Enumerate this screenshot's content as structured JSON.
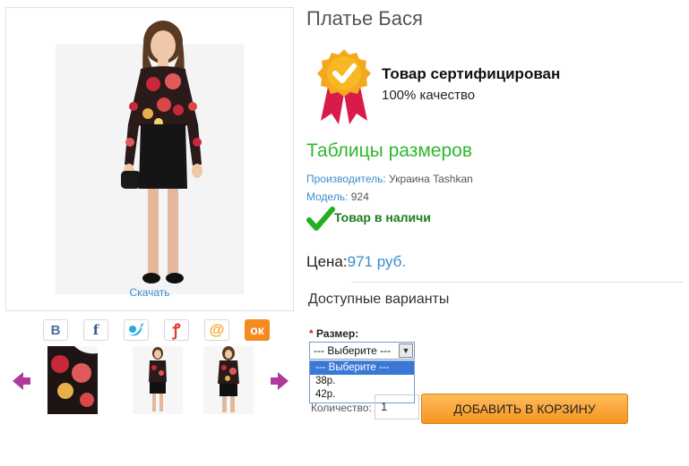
{
  "product": {
    "title": "Платье Бася",
    "download_label": "Скачать"
  },
  "certificate": {
    "title": "Товар сертифицирован",
    "subtitle": "100% качество"
  },
  "size_table_link": "Таблицы размеров",
  "meta": {
    "manufacturer_label": "Производитель:",
    "manufacturer_value": "Украина Tashkan",
    "model_label": "Модель:",
    "model_value": "924"
  },
  "stock": "Товар в наличи",
  "price": {
    "label": "Цена:",
    "value": "971 руб."
  },
  "variants": {
    "heading": "Доступные варианты",
    "size_label": "Размер:",
    "select_value": "--- Выберите ---",
    "options": [
      "--- Выберите ---",
      "38р.",
      "42р."
    ]
  },
  "quantity": {
    "label": "Количество:",
    "value": "1"
  },
  "cart_button": "ДОБАВИТЬ В КОРЗИНУ",
  "colors": {
    "link_blue": "#3a8ecb",
    "size_table_green": "#2eb82e",
    "cart_orange": "#f5961e"
  },
  "social": [
    "vk-icon",
    "facebook-icon",
    "twitter-icon",
    "odnoklassniki-icon",
    "mailru-icon",
    "ok-icon"
  ]
}
